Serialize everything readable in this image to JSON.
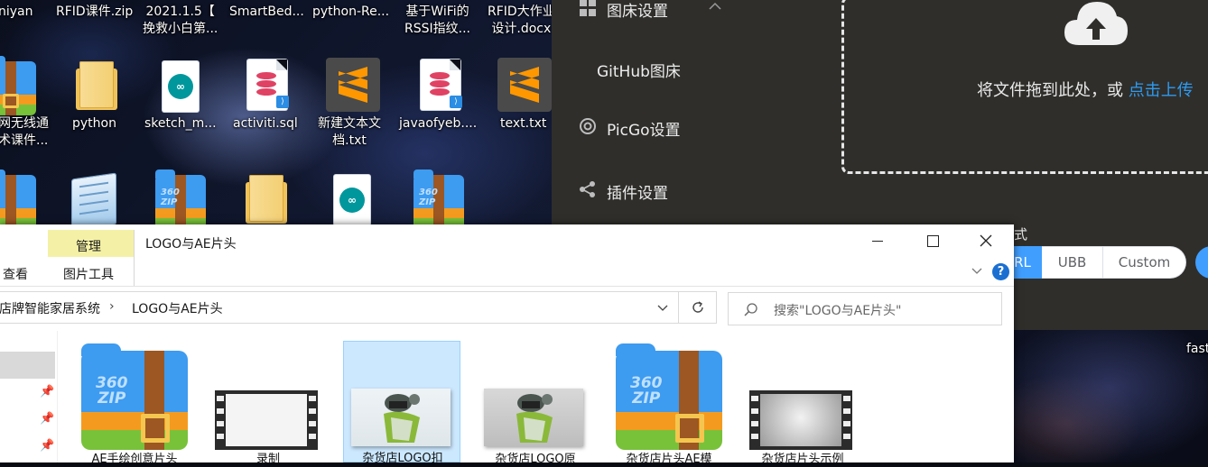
{
  "desktop": {
    "top_row": [
      {
        "label": "niyan"
      },
      {
        "label": "RFID课件.zip"
      },
      {
        "label_line1": "2021.1.5【",
        "label_line2": "挽救小白第..."
      },
      {
        "label": "SmartBed..."
      },
      {
        "label": "python-Re..."
      },
      {
        "label_line1": "基于WiFi的",
        "label_line2": "RSSI指纹..."
      },
      {
        "label_line1": "RFID大作业",
        "label_line2": "设计.docx"
      }
    ],
    "mid_row": [
      {
        "label_line1": "网无线通",
        "label_line2": "术课件...",
        "icon": "zip-archive-icon"
      },
      {
        "label": "python",
        "icon": "folder-icon"
      },
      {
        "label": "sketch_m...",
        "icon": "arduino-file-icon"
      },
      {
        "label": "activiti.sql",
        "icon": "sql-file-icon"
      },
      {
        "label_line1": "新建文本文",
        "label_line2": "档.txt",
        "icon": "sublime-text-icon"
      },
      {
        "label": "javaofyeb....",
        "icon": "sql-file-icon"
      },
      {
        "label": "text.txt",
        "icon": "sublime-text-icon"
      }
    ],
    "right_label": "fast"
  },
  "picgo": {
    "menu_image_host": "图床设置",
    "menu_github": "GitHub图床",
    "menu_picgo_settings": "PicGo设置",
    "menu_plugins": "插件设置",
    "drop_text": "将文件拖到此处，或 ",
    "drop_link": "点击上传",
    "link_format_label_partial": "式",
    "formats": [
      "RL",
      "UBB",
      "Custom"
    ]
  },
  "explorer": {
    "tab_manage": "管理",
    "window_title": "LOGO与AE片头",
    "tab_view": "查看",
    "tab_picture_tools": "图片工具",
    "breadcrumb_parent": "店牌智能家居系统",
    "breadcrumb_current": "LOGO与AE片头",
    "search_placeholder": "搜索\"LOGO与AE片头\"",
    "files": [
      {
        "label": "AE手绘创意片头",
        "type": "zip"
      },
      {
        "label": "录制",
        "type": "video-blank"
      },
      {
        "label": "杂货店LOGO扣",
        "type": "image-logo",
        "selected": true
      },
      {
        "label": "杂货店LOGO原",
        "type": "image-logo-gray"
      },
      {
        "label": "杂货店片头AE模",
        "type": "zip"
      },
      {
        "label": "杂货店片头示例",
        "type": "video-gray"
      }
    ]
  },
  "colors": {
    "picgo_bg": "#2f2e2b",
    "link_blue": "#2e9bf0",
    "manage_tab_bg": "#f4f1a6",
    "selection_bg": "#cce8ff"
  }
}
